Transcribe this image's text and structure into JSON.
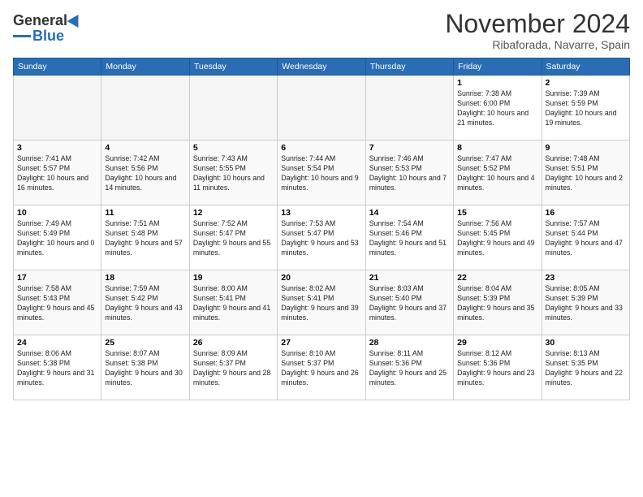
{
  "logo": {
    "general": "General",
    "blue": "Blue"
  },
  "title": "November 2024",
  "location": "Ribaforada, Navarre, Spain",
  "headers": [
    "Sunday",
    "Monday",
    "Tuesday",
    "Wednesday",
    "Thursday",
    "Friday",
    "Saturday"
  ],
  "weeks": [
    [
      {
        "day": "",
        "empty": true
      },
      {
        "day": "",
        "empty": true
      },
      {
        "day": "",
        "empty": true
      },
      {
        "day": "",
        "empty": true
      },
      {
        "day": "",
        "empty": true
      },
      {
        "day": "1",
        "sunrise": "Sunrise: 7:38 AM",
        "sunset": "Sunset: 6:00 PM",
        "daylight": "Daylight: 10 hours and 21 minutes."
      },
      {
        "day": "2",
        "sunrise": "Sunrise: 7:39 AM",
        "sunset": "Sunset: 5:59 PM",
        "daylight": "Daylight: 10 hours and 19 minutes."
      }
    ],
    [
      {
        "day": "3",
        "sunrise": "Sunrise: 7:41 AM",
        "sunset": "Sunset: 5:57 PM",
        "daylight": "Daylight: 10 hours and 16 minutes."
      },
      {
        "day": "4",
        "sunrise": "Sunrise: 7:42 AM",
        "sunset": "Sunset: 5:56 PM",
        "daylight": "Daylight: 10 hours and 14 minutes."
      },
      {
        "day": "5",
        "sunrise": "Sunrise: 7:43 AM",
        "sunset": "Sunset: 5:55 PM",
        "daylight": "Daylight: 10 hours and 11 minutes."
      },
      {
        "day": "6",
        "sunrise": "Sunrise: 7:44 AM",
        "sunset": "Sunset: 5:54 PM",
        "daylight": "Daylight: 10 hours and 9 minutes."
      },
      {
        "day": "7",
        "sunrise": "Sunrise: 7:46 AM",
        "sunset": "Sunset: 5:53 PM",
        "daylight": "Daylight: 10 hours and 7 minutes."
      },
      {
        "day": "8",
        "sunrise": "Sunrise: 7:47 AM",
        "sunset": "Sunset: 5:52 PM",
        "daylight": "Daylight: 10 hours and 4 minutes."
      },
      {
        "day": "9",
        "sunrise": "Sunrise: 7:48 AM",
        "sunset": "Sunset: 5:51 PM",
        "daylight": "Daylight: 10 hours and 2 minutes."
      }
    ],
    [
      {
        "day": "10",
        "sunrise": "Sunrise: 7:49 AM",
        "sunset": "Sunset: 5:49 PM",
        "daylight": "Daylight: 10 hours and 0 minutes."
      },
      {
        "day": "11",
        "sunrise": "Sunrise: 7:51 AM",
        "sunset": "Sunset: 5:48 PM",
        "daylight": "Daylight: 9 hours and 57 minutes."
      },
      {
        "day": "12",
        "sunrise": "Sunrise: 7:52 AM",
        "sunset": "Sunset: 5:47 PM",
        "daylight": "Daylight: 9 hours and 55 minutes."
      },
      {
        "day": "13",
        "sunrise": "Sunrise: 7:53 AM",
        "sunset": "Sunset: 5:47 PM",
        "daylight": "Daylight: 9 hours and 53 minutes."
      },
      {
        "day": "14",
        "sunrise": "Sunrise: 7:54 AM",
        "sunset": "Sunset: 5:46 PM",
        "daylight": "Daylight: 9 hours and 51 minutes."
      },
      {
        "day": "15",
        "sunrise": "Sunrise: 7:56 AM",
        "sunset": "Sunset: 5:45 PM",
        "daylight": "Daylight: 9 hours and 49 minutes."
      },
      {
        "day": "16",
        "sunrise": "Sunrise: 7:57 AM",
        "sunset": "Sunset: 5:44 PM",
        "daylight": "Daylight: 9 hours and 47 minutes."
      }
    ],
    [
      {
        "day": "17",
        "sunrise": "Sunrise: 7:58 AM",
        "sunset": "Sunset: 5:43 PM",
        "daylight": "Daylight: 9 hours and 45 minutes."
      },
      {
        "day": "18",
        "sunrise": "Sunrise: 7:59 AM",
        "sunset": "Sunset: 5:42 PM",
        "daylight": "Daylight: 9 hours and 43 minutes."
      },
      {
        "day": "19",
        "sunrise": "Sunrise: 8:00 AM",
        "sunset": "Sunset: 5:41 PM",
        "daylight": "Daylight: 9 hours and 41 minutes."
      },
      {
        "day": "20",
        "sunrise": "Sunrise: 8:02 AM",
        "sunset": "Sunset: 5:41 PM",
        "daylight": "Daylight: 9 hours and 39 minutes."
      },
      {
        "day": "21",
        "sunrise": "Sunrise: 8:03 AM",
        "sunset": "Sunset: 5:40 PM",
        "daylight": "Daylight: 9 hours and 37 minutes."
      },
      {
        "day": "22",
        "sunrise": "Sunrise: 8:04 AM",
        "sunset": "Sunset: 5:39 PM",
        "daylight": "Daylight: 9 hours and 35 minutes."
      },
      {
        "day": "23",
        "sunrise": "Sunrise: 8:05 AM",
        "sunset": "Sunset: 5:39 PM",
        "daylight": "Daylight: 9 hours and 33 minutes."
      }
    ],
    [
      {
        "day": "24",
        "sunrise": "Sunrise: 8:06 AM",
        "sunset": "Sunset: 5:38 PM",
        "daylight": "Daylight: 9 hours and 31 minutes."
      },
      {
        "day": "25",
        "sunrise": "Sunrise: 8:07 AM",
        "sunset": "Sunset: 5:38 PM",
        "daylight": "Daylight: 9 hours and 30 minutes."
      },
      {
        "day": "26",
        "sunrise": "Sunrise: 8:09 AM",
        "sunset": "Sunset: 5:37 PM",
        "daylight": "Daylight: 9 hours and 28 minutes."
      },
      {
        "day": "27",
        "sunrise": "Sunrise: 8:10 AM",
        "sunset": "Sunset: 5:37 PM",
        "daylight": "Daylight: 9 hours and 26 minutes."
      },
      {
        "day": "28",
        "sunrise": "Sunrise: 8:11 AM",
        "sunset": "Sunset: 5:36 PM",
        "daylight": "Daylight: 9 hours and 25 minutes."
      },
      {
        "day": "29",
        "sunrise": "Sunrise: 8:12 AM",
        "sunset": "Sunset: 5:36 PM",
        "daylight": "Daylight: 9 hours and 23 minutes."
      },
      {
        "day": "30",
        "sunrise": "Sunrise: 8:13 AM",
        "sunset": "Sunset: 5:35 PM",
        "daylight": "Daylight: 9 hours and 22 minutes."
      }
    ]
  ]
}
